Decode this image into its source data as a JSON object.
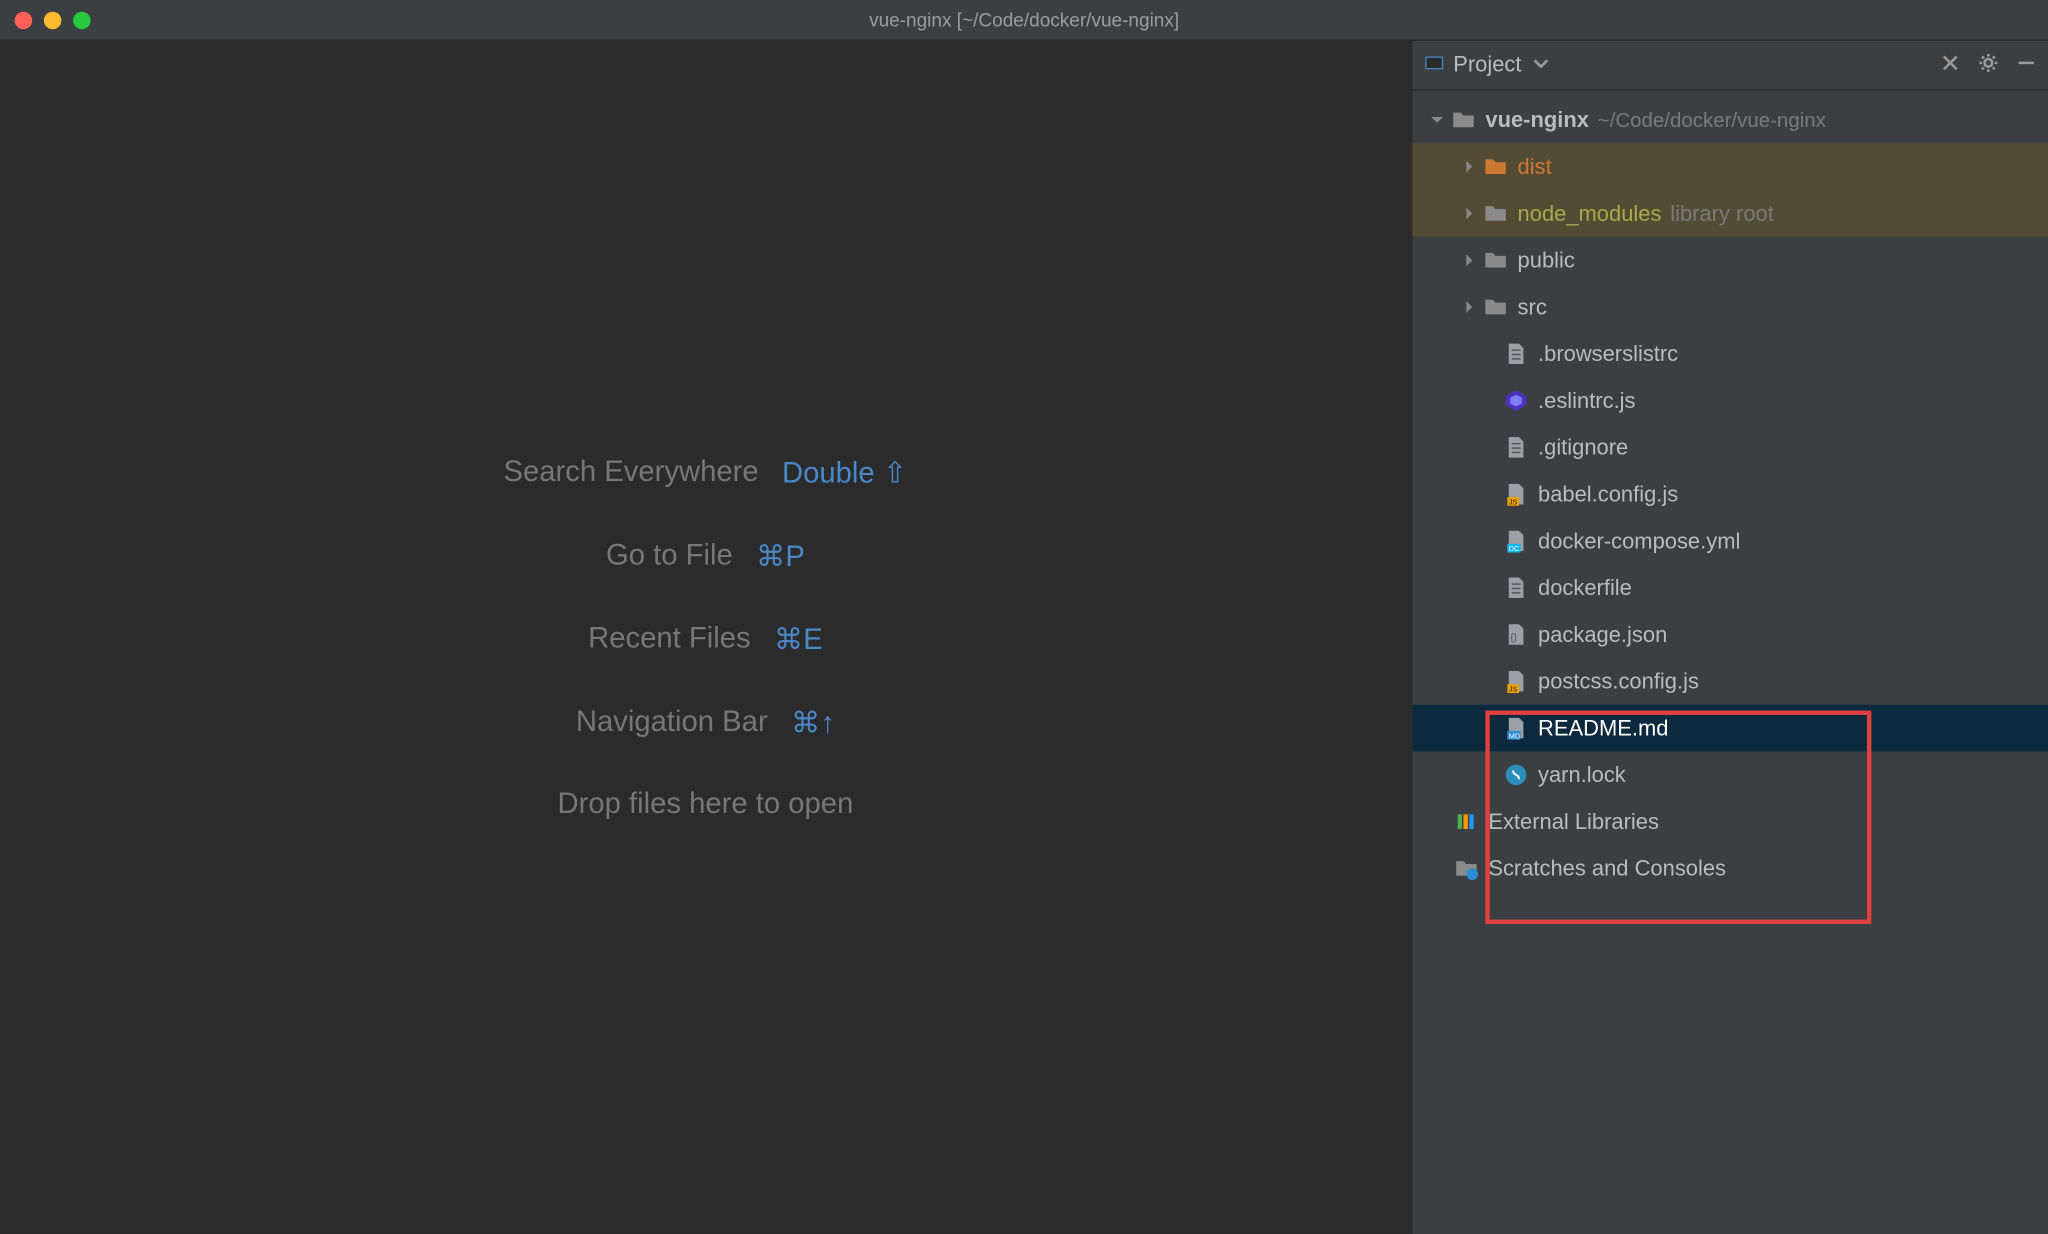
{
  "titlebar": {
    "title": "vue-nginx [~/Code/docker/vue-nginx]"
  },
  "editor": {
    "rows": [
      {
        "label": "Search Everywhere",
        "shortcut": "Double ⇧"
      },
      {
        "label": "Go to File",
        "shortcut": "⌘P"
      },
      {
        "label": "Recent Files",
        "shortcut": "⌘E"
      },
      {
        "label": "Navigation Bar",
        "shortcut": "⌘↑"
      }
    ],
    "drop": "Drop files here to open"
  },
  "sidebar": {
    "header": {
      "title": "Project"
    },
    "root": {
      "name": "vue-nginx",
      "path": "~/Code/docker/vue-nginx"
    },
    "folders": [
      {
        "name": "dist",
        "style": "orange",
        "arrow": "right",
        "lib_root": true
      },
      {
        "name": "node_modules",
        "style": "olive",
        "arrow": "right",
        "lib": "library root",
        "lib_root": true
      },
      {
        "name": "public",
        "style": "",
        "arrow": "right"
      },
      {
        "name": "src",
        "style": "",
        "arrow": "right"
      }
    ],
    "files": [
      {
        "name": ".browserslistrc",
        "icon": "file",
        "selected": false
      },
      {
        "name": ".eslintrc.js",
        "icon": "eslint",
        "selected": false
      },
      {
        "name": ".gitignore",
        "icon": "file",
        "selected": false
      },
      {
        "name": "babel.config.js",
        "icon": "js",
        "selected": false
      },
      {
        "name": "docker-compose.yml",
        "icon": "dc",
        "selected": false,
        "hl": true
      },
      {
        "name": "dockerfile",
        "icon": "file",
        "selected": false,
        "hl": true
      },
      {
        "name": "package.json",
        "icon": "json",
        "selected": false,
        "hl": true
      },
      {
        "name": "postcss.config.js",
        "icon": "js",
        "selected": false
      },
      {
        "name": "README.md",
        "icon": "md",
        "selected": true
      },
      {
        "name": "yarn.lock",
        "icon": "yarn",
        "selected": false
      }
    ],
    "extra": [
      {
        "name": "External Libraries",
        "icon": "lib"
      },
      {
        "name": "Scratches and Consoles",
        "icon": "scratch"
      }
    ]
  }
}
